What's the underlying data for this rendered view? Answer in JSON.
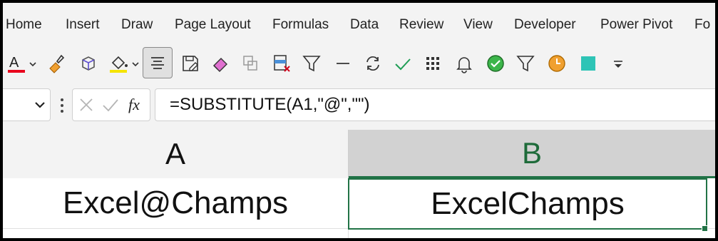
{
  "ribbon": {
    "tabs": [
      "Home",
      "Insert",
      "Draw",
      "Page Layout",
      "Formulas",
      "Data",
      "Review",
      "View",
      "Developer",
      "Power Pivot",
      "Fo"
    ]
  },
  "toolbar": {
    "icons": [
      "font-color-icon",
      "format-painter-icon",
      "3d-model-icon",
      "fill-color-icon",
      "align-center-icon",
      "save-as-icon",
      "eraser-icon",
      "copy-format-icon",
      "delete-table-icon",
      "filter-icon",
      "line-icon",
      "refresh-icon",
      "check-icon",
      "grid-icon",
      "bell-icon",
      "green-check-circle-icon",
      "funnel-icon",
      "clock-icon",
      "teal-square-icon",
      "customize-dropdown-icon"
    ],
    "colors": {
      "font_color_bar": "#e8001c",
      "fill_color_bar": "#f5e400",
      "accent_green": "#217346",
      "teal": "#2ec4b6",
      "orange": "#f0a030"
    }
  },
  "formula_bar": {
    "fx_label": "fx",
    "formula": "=SUBSTITUTE(A1,\"@\",\"\")"
  },
  "sheet": {
    "columns": [
      "A",
      "B"
    ],
    "rows": [
      {
        "A": "Excel@Champs",
        "B": "ExcelChamps"
      }
    ],
    "selected_cell": "B1",
    "selection_color": "#217346"
  }
}
